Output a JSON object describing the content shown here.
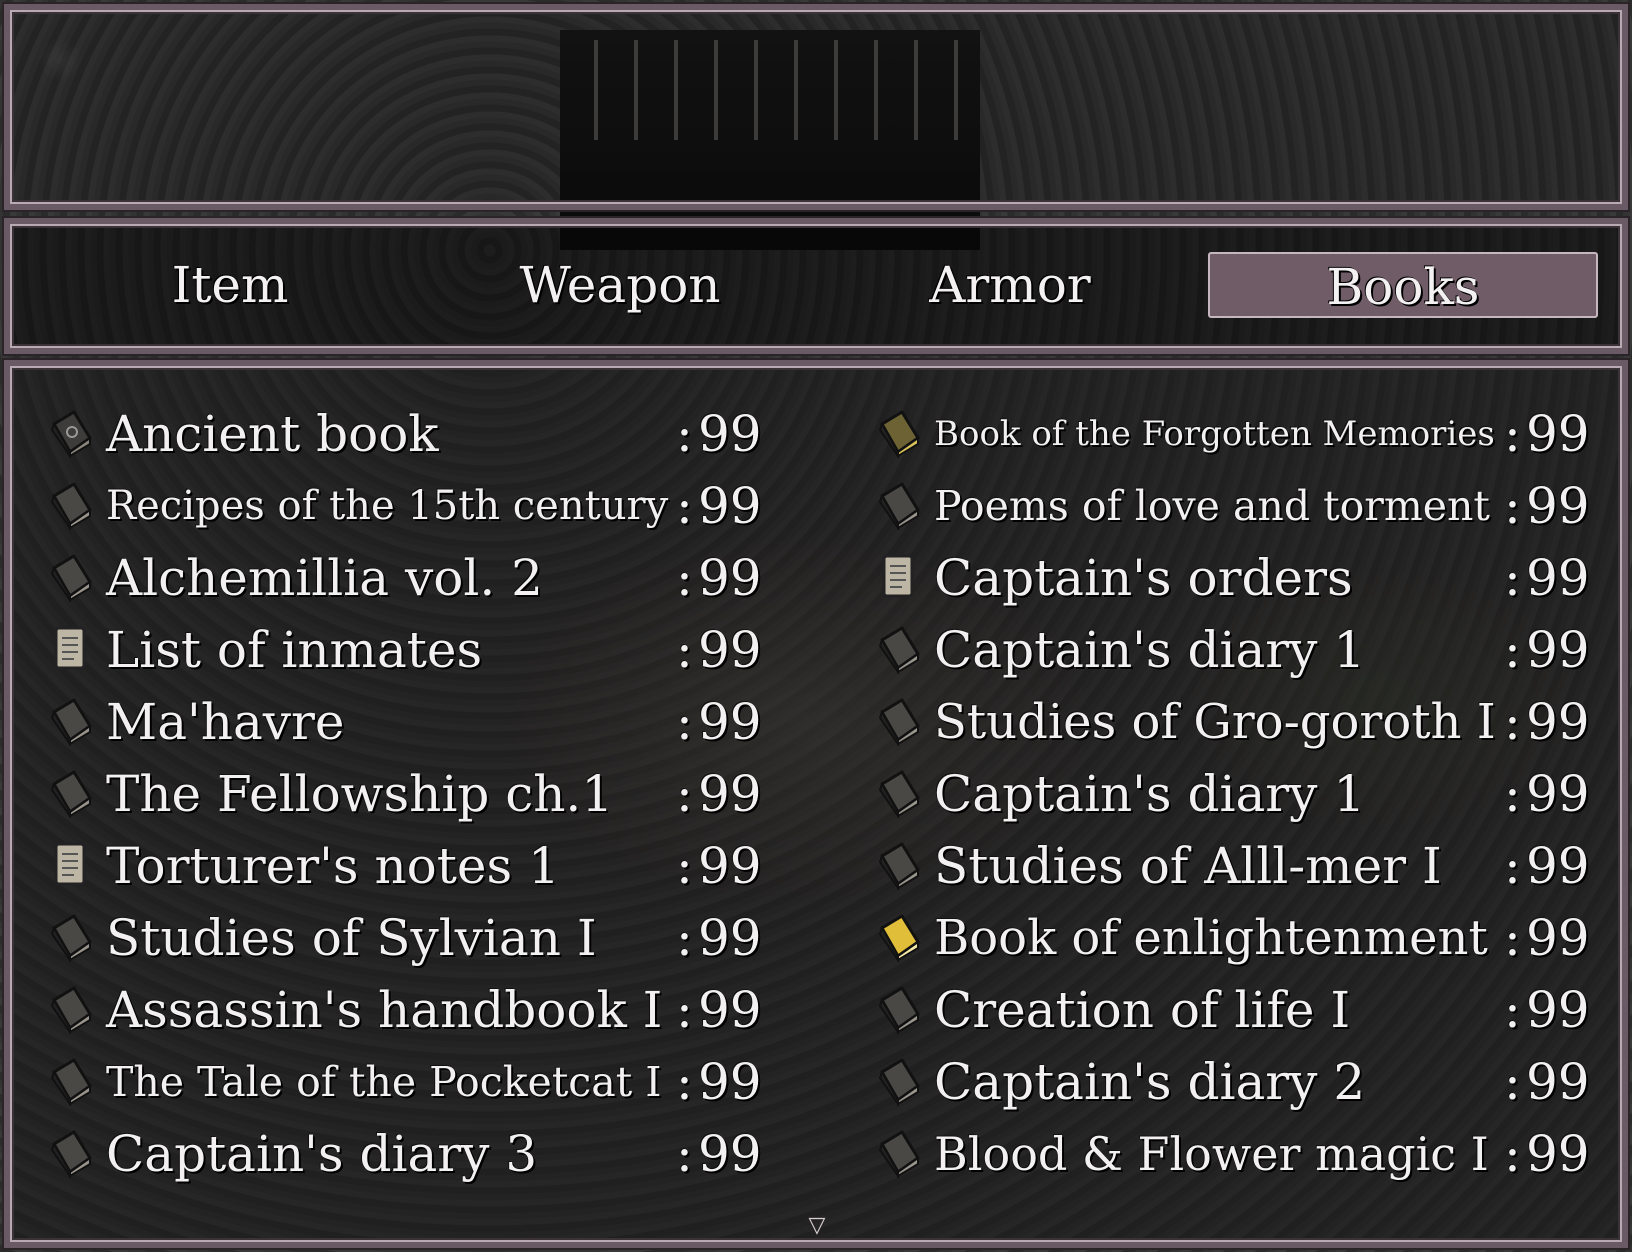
{
  "tabs": [
    {
      "label": "Item",
      "selected": false
    },
    {
      "label": "Weapon",
      "selected": false
    },
    {
      "label": "Armor",
      "selected": false
    },
    {
      "label": "Books",
      "selected": true
    }
  ],
  "colors": {
    "selected_tab": "#6f5c67",
    "frame": "#6a5a66",
    "text": "#f2f0f1",
    "book_dark": "#4a4845",
    "book_gold": "#e0be3a",
    "scroll": "#bdb6a4"
  },
  "items_left": [
    {
      "name": "Ancient book",
      "qty": "99",
      "icon": "ancient-book-icon"
    },
    {
      "name": "Recipes of the 15th century",
      "qty": "99",
      "icon": "book-icon"
    },
    {
      "name": "Alchemillia vol. 2",
      "qty": "99",
      "icon": "book-icon"
    },
    {
      "name": "List of inmates",
      "qty": "99",
      "icon": "scroll-icon"
    },
    {
      "name": "Ma'havre",
      "qty": "99",
      "icon": "book-icon"
    },
    {
      "name": "The Fellowship ch.1",
      "qty": "99",
      "icon": "book-icon"
    },
    {
      "name": "Torturer's notes 1",
      "qty": "99",
      "icon": "scroll-icon"
    },
    {
      "name": "Studies of Sylvian I",
      "qty": "99",
      "icon": "book-icon"
    },
    {
      "name": "Assassin's handbook I",
      "qty": "99",
      "icon": "book-icon"
    },
    {
      "name": "The Tale of the Pocketcat I",
      "qty": "99",
      "icon": "book-icon"
    },
    {
      "name": "Captain's diary 3",
      "qty": "99",
      "icon": "book-icon"
    }
  ],
  "items_right": [
    {
      "name": "Book of the Forgotten Memories",
      "qty": "99",
      "icon": "golden-book-icon"
    },
    {
      "name": "Poems of love and torment",
      "qty": "99",
      "icon": "book-icon"
    },
    {
      "name": "Captain's orders",
      "qty": "99",
      "icon": "scroll-icon"
    },
    {
      "name": "Captain's diary 1",
      "qty": "99",
      "icon": "book-icon"
    },
    {
      "name": "Studies of Gro-goroth I",
      "qty": "99",
      "icon": "book-icon"
    },
    {
      "name": "Captain's diary 1",
      "qty": "99",
      "icon": "book-icon"
    },
    {
      "name": "Studies of Alll-mer I",
      "qty": "99",
      "icon": "book-icon"
    },
    {
      "name": "Book of enlightenment",
      "qty": "99",
      "icon": "yellow-book-icon"
    },
    {
      "name": "Creation of life I",
      "qty": "99",
      "icon": "book-icon"
    },
    {
      "name": "Captain's diary 2",
      "qty": "99",
      "icon": "book-icon"
    },
    {
      "name": "Blood & Flower magic I",
      "qty": "99",
      "icon": "book-icon"
    }
  ],
  "separator": ":"
}
